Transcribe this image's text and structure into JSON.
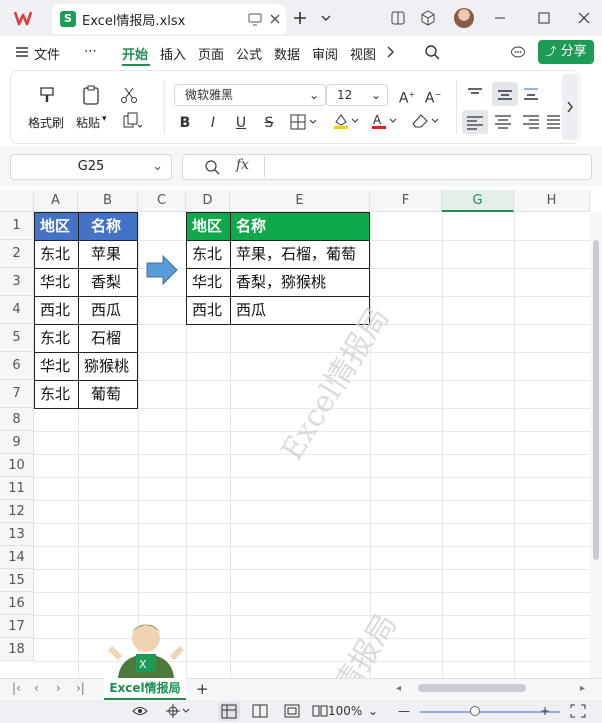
{
  "window": {
    "tab_title": "Excel情报局.xlsx",
    "sheet_icon_letter": "S"
  },
  "menu": {
    "items": [
      "文件",
      "开始",
      "插入",
      "页面",
      "公式",
      "数据",
      "审阅",
      "视图"
    ],
    "active": "开始",
    "more": "⋯",
    "share_label": "分享"
  },
  "ribbon": {
    "format_painter": "格式刷",
    "paste": "粘贴",
    "font_name": "微软雅黑",
    "font_size": "12",
    "bold": "B",
    "italic": "I",
    "underline": "U",
    "strike": "S"
  },
  "formula_bar": {
    "name_box": "G25",
    "fx": "fx",
    "content": ""
  },
  "grid": {
    "columns": [
      "A",
      "B",
      "C",
      "D",
      "E",
      "F",
      "G",
      "H"
    ],
    "selected_column": "G",
    "rows": [
      "1",
      "2",
      "3",
      "4",
      "5",
      "6",
      "7",
      "8",
      "9",
      "10",
      "11",
      "12",
      "13",
      "14",
      "15",
      "16",
      "17",
      "18"
    ],
    "source_table": {
      "headers": [
        "地区",
        "名称"
      ],
      "rows": [
        [
          "东北",
          "苹果"
        ],
        [
          "华北",
          "香梨"
        ],
        [
          "西北",
          "西瓜"
        ],
        [
          "东北",
          "石榴"
        ],
        [
          "华北",
          "猕猴桃"
        ],
        [
          "东北",
          "葡萄"
        ]
      ]
    },
    "result_table": {
      "headers": [
        "地区",
        "名称"
      ],
      "rows": [
        [
          "东北",
          "苹果，石榴，葡萄"
        ],
        [
          "华北",
          "香梨，猕猴桃"
        ],
        [
          "西北",
          "西瓜"
        ]
      ]
    },
    "watermark": "Excel情报局",
    "watermark_partial": "情报局"
  },
  "sheets": {
    "active": "Excel情报局",
    "add": "+"
  },
  "status": {
    "zoom": "100%"
  },
  "colors": {
    "accent": "#1e8f4e",
    "source_header": "#4472c4",
    "result_header": "#0fa84a",
    "arrow": "#5b9bd5"
  }
}
